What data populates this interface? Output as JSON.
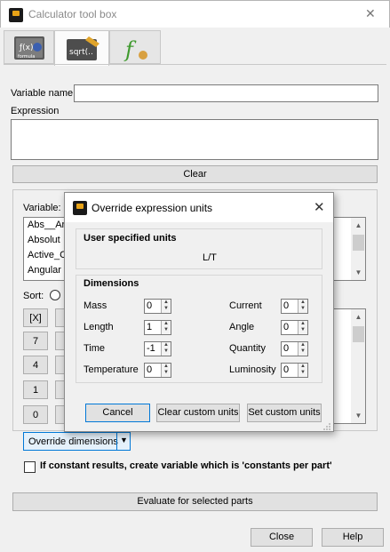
{
  "window": {
    "title": "Calculator tool box",
    "close_glyph": "✕"
  },
  "tabs": [
    {
      "icon": "formula-tab-icon",
      "caption": "formula"
    },
    {
      "icon": "sqrt-tab-icon",
      "caption": "sqrt(.."
    },
    {
      "icon": "function-tab-icon",
      "caption": "f"
    }
  ],
  "main": {
    "variable_name_label": "Variable name",
    "variable_name_value": "",
    "expression_label": "Expression",
    "expression_value": "",
    "clear_button": "Clear",
    "variable_label": "Variable:",
    "variable_list": [
      "Abs__Ar",
      "Absolut",
      "Active_C",
      "Angular"
    ],
    "sort_label": "Sort:",
    "calc_buttons": [
      "[X]",
      "7",
      "4",
      "1",
      "0"
    ],
    "override_dropdown": "Override dimensions",
    "constant_checkbox_label": "If constant results, create variable which is 'constants per part'",
    "evaluate_button": "Evaluate for selected parts",
    "close_button": "Close",
    "help_button": "Help"
  },
  "dialog": {
    "title": "Override expression units",
    "close_glyph": "✕",
    "user_units_title": "User specified units",
    "user_units_value": "L/T",
    "dimensions_title": "Dimensions",
    "dimensions_left": [
      {
        "label": "Mass",
        "value": "0"
      },
      {
        "label": "Length",
        "value": "1"
      },
      {
        "label": "Time",
        "value": "-1"
      },
      {
        "label": "Temperature",
        "value": "0"
      }
    ],
    "dimensions_right": [
      {
        "label": "Current",
        "value": "0"
      },
      {
        "label": "Angle",
        "value": "0"
      },
      {
        "label": "Quantity",
        "value": "0"
      },
      {
        "label": "Luminosity",
        "value": "0"
      }
    ],
    "cancel_button": "Cancel",
    "clear_custom_button": "Clear custom units",
    "set_custom_button": "Set custom units"
  }
}
